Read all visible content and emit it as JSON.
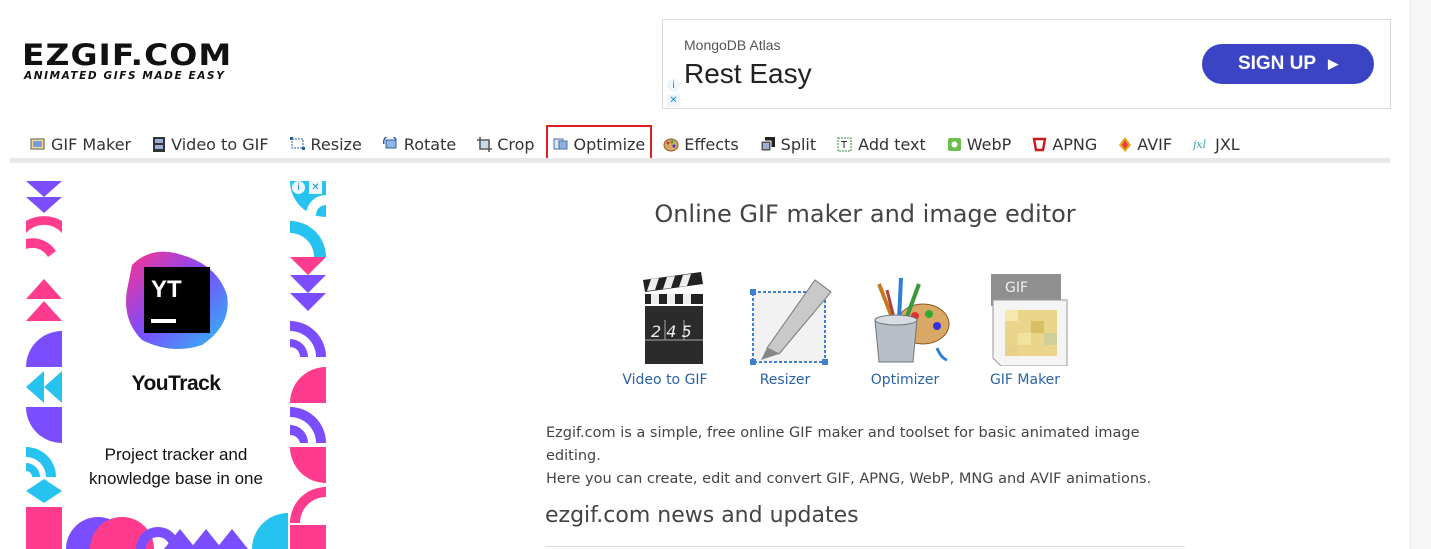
{
  "logo": {
    "main": "EZGIF.COM",
    "tagline": "ANIMATED GIFS MADE EASY"
  },
  "top_ad": {
    "brand": "MongoDB Atlas",
    "headline": "Rest Easy",
    "cta": "SIGN UP",
    "cta_arrow": "▶"
  },
  "nav": {
    "items": [
      {
        "label": "GIF Maker",
        "icon": "gif-maker-icon"
      },
      {
        "label": "Video to GIF",
        "icon": "film-icon"
      },
      {
        "label": "Resize",
        "icon": "resize-icon"
      },
      {
        "label": "Rotate",
        "icon": "rotate-icon"
      },
      {
        "label": "Crop",
        "icon": "crop-icon"
      },
      {
        "label": "Optimize",
        "icon": "optimize-icon",
        "highlighted": true
      },
      {
        "label": "Effects",
        "icon": "palette-icon"
      },
      {
        "label": "Split",
        "icon": "split-icon"
      },
      {
        "label": "Add text",
        "icon": "add-text-icon"
      },
      {
        "label": "WebP",
        "icon": "webp-icon"
      },
      {
        "label": "APNG",
        "icon": "apng-icon"
      },
      {
        "label": "AVIF",
        "icon": "avif-icon"
      },
      {
        "label": "JXL",
        "icon": "jxl-icon"
      }
    ],
    "highlight_color": "#e02020"
  },
  "side_ad": {
    "logo_text": "YT",
    "product": "YouTrack",
    "tagline": "Project tracker and knowledge base in one"
  },
  "main": {
    "title": "Online GIF maker and image editor",
    "tools": [
      {
        "label": "Video to GIF",
        "icon": "clapperboard-icon"
      },
      {
        "label": "Resizer",
        "icon": "resizer-icon"
      },
      {
        "label": "Optimizer",
        "icon": "paint-brushes-icon"
      },
      {
        "label": "GIF Maker",
        "icon": "gif-file-icon"
      }
    ],
    "clapper_digits": "2 4 5",
    "gif_badge": "GIF",
    "description_line1": "Ezgif.com is a simple, free online GIF maker and toolset for basic animated image editing.",
    "description_line2": "Here you can create, edit and convert GIF, APNG, WebP, MNG and AVIF animations.",
    "news_heading": "ezgif.com news and updates"
  },
  "colors": {
    "link": "#2a62a8",
    "cta": "#3b44c4",
    "text": "#333333"
  }
}
